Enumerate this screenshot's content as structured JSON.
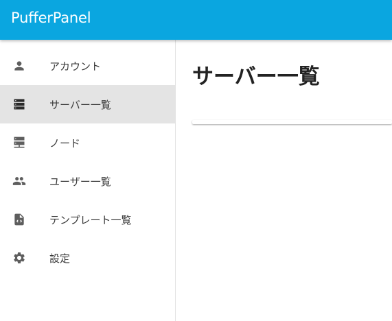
{
  "app": {
    "title": "PufferPanel",
    "accent_color": "#0aa6e0"
  },
  "sidebar": {
    "items": [
      {
        "label": "アカウント",
        "icon": "person-icon",
        "active": false
      },
      {
        "label": "サーバー一覧",
        "icon": "dns-icon",
        "active": true
      },
      {
        "label": "ノード",
        "icon": "node-icon",
        "active": false
      },
      {
        "label": "ユーザー一覧",
        "icon": "people-icon",
        "active": false
      },
      {
        "label": "テンプレート一覧",
        "icon": "code-file-icon",
        "active": false
      },
      {
        "label": "設定",
        "icon": "gear-icon",
        "active": false
      }
    ]
  },
  "main": {
    "title": "サーバー一覧"
  }
}
